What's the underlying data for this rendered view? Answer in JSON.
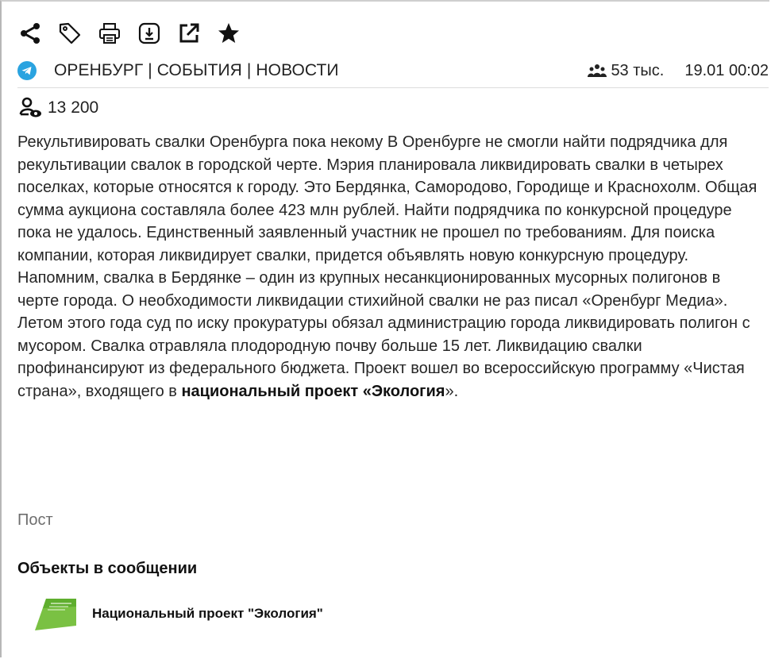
{
  "toolbar": {
    "share_icon": "share-icon",
    "tag_icon": "tag-icon",
    "print_icon": "print-icon",
    "download_icon": "download-icon",
    "open_external_icon": "open-external-icon",
    "favorite_icon": "star-icon"
  },
  "post": {
    "source": "ОРЕНБУРГ | СОБЫТИЯ | НОВОСТИ",
    "audience": "53 тыс.",
    "date": "19.01 00:02",
    "views": "13 200",
    "text_main": "Рекультивировать свалки Оренбурга пока некому В Оренбурге не смогли найти подрядчика для рекультивации свалок в городской черте. Мэрия планировала ликвидировать свалки в четырех поселках, которые относятся к городу. Это Бердянка, Самородово, Городище и Краснохолм. Общая сумма аукциона составляла более 423 млн рублей. Найти подрядчика по конкурсной процедуре пока не удалось. Единственный заявленный участник не прошел по требованиям. Для поиска компании, которая ликвидирует свалки, придется объявлять новую конкурсную процедуру. Напомним, свалка в Бердянке – один из крупных несанкционированных мусорных полигонов в черте города. О необходимости ликвидации стихийной свалки не раз писал «Оренбург Медиа». Летом этого года суд по иску прокуратуры обязал администрацию города ликвидировать полигон с мусором. Свалка отравляла плодородную почву больше 15 лет. Ликвидацию свалки профинансируют из федерального бюджета. Проект вошел во всероссийскую программу «Чистая страна», входящего в ",
    "text_highlight": "национальный проект «Экология",
    "text_tail": "».",
    "type": "Пост"
  },
  "objects": {
    "title": "Объекты в сообщении",
    "items": [
      {
        "name": "Национальный проект \"Экология\"",
        "logo_color": "#7ac143"
      }
    ]
  },
  "colors": {
    "telegram": "#2aa3e0",
    "text": "#262626",
    "muted": "#6e6e6e"
  }
}
